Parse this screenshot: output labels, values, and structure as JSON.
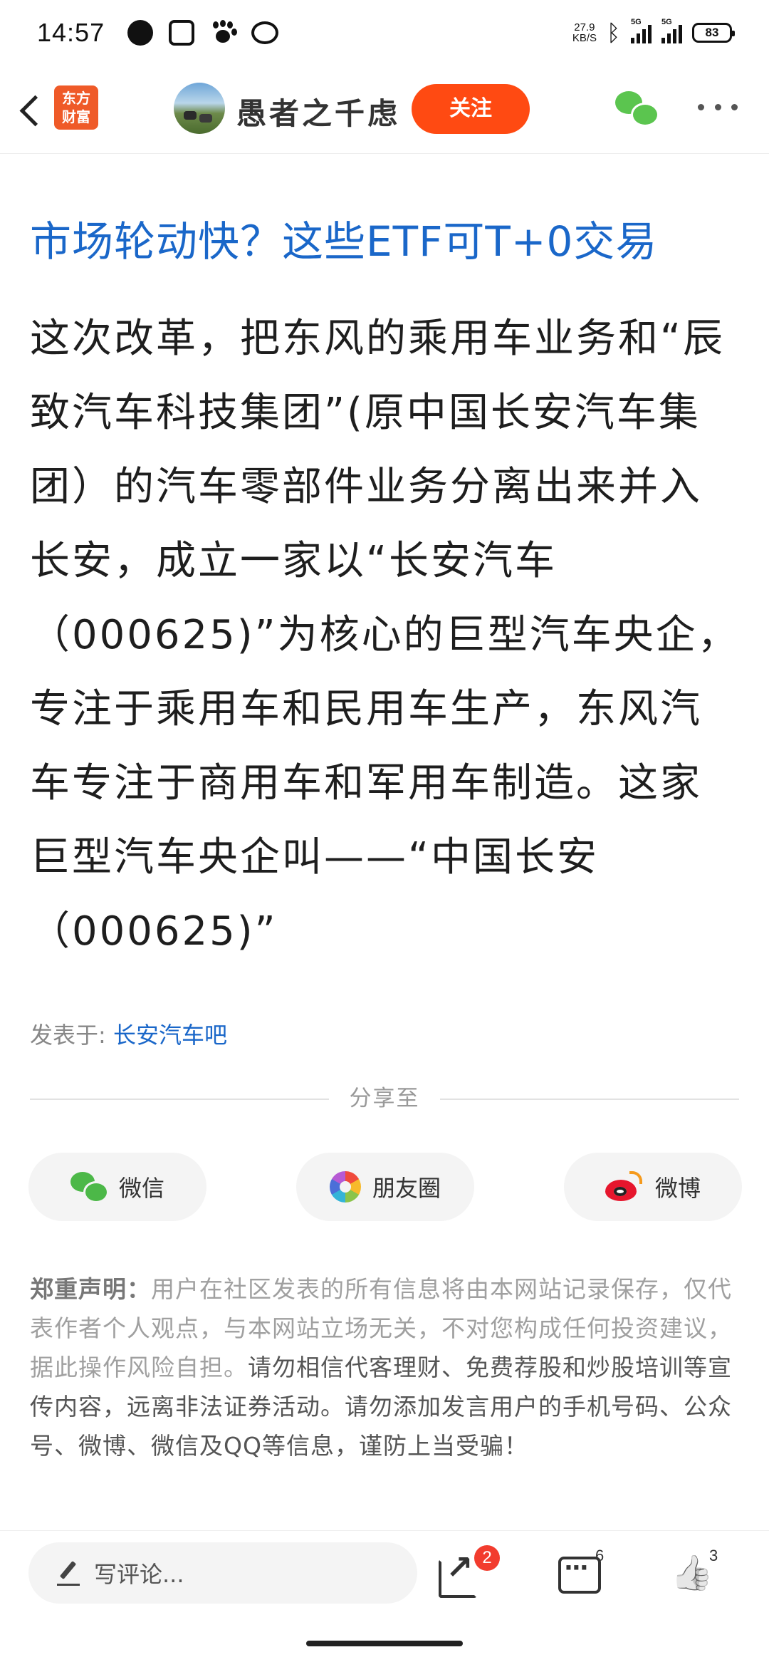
{
  "status_bar": {
    "time": "14:57",
    "net_speed_value": "27.9",
    "net_speed_unit": "KB/S",
    "signal_1": "5G",
    "signal_2": "5G",
    "battery": "83"
  },
  "header": {
    "site_logo_line1": "东方",
    "site_logo_line2": "财富",
    "author_name": "愚者之千虑",
    "follow_label": "关注"
  },
  "article": {
    "link_text": "市场轮动快？这些ETF可T+0交易",
    "body_lines": [
      "这次改革，把东风的乘用车业务和“辰",
      "致汽车科技集团”(原中国长安汽车集",
      "团）的汽车零部件业务分离出来并入",
      "长安，成立一家以“长安汽车",
      "（000625)”为核心的巨型汽车央企，",
      "专注于乘用车和民用车生产，东风汽",
      "车专注于商用车和军用车制造。这家",
      "巨型汽车央企叫——“中国长安",
      "（000625)”"
    ]
  },
  "posted_in": {
    "label": "发表于:",
    "board": "长安汽车吧"
  },
  "share": {
    "divider_label": "分享至",
    "wechat_label": "微信",
    "moments_label": "朋友圈",
    "weibo_label": "微博"
  },
  "disclaimer": {
    "title": "郑重声明：",
    "part1": "用户在社区发表的所有信息将由本网站记录保存，仅代表作者个人观点，与本网站立场无关，不对您构成任何投资建议，据此操作风险自担。",
    "part2": "请勿相信代客理财、免费荐股和炒股培训等宣传内容，远离非法证券活动。请勿添加发言用户的手机号码、公众号、微博、微信及QQ等信息，谨防上当受骗！"
  },
  "bottom_bar": {
    "comment_placeholder": "写评论...",
    "share_badge": "2",
    "comments_count": "6",
    "likes_count": "3"
  },
  "colors": {
    "accent_orange": "#ff4a12",
    "link_blue": "#1a67c9",
    "badge_red": "#f23c2e"
  }
}
